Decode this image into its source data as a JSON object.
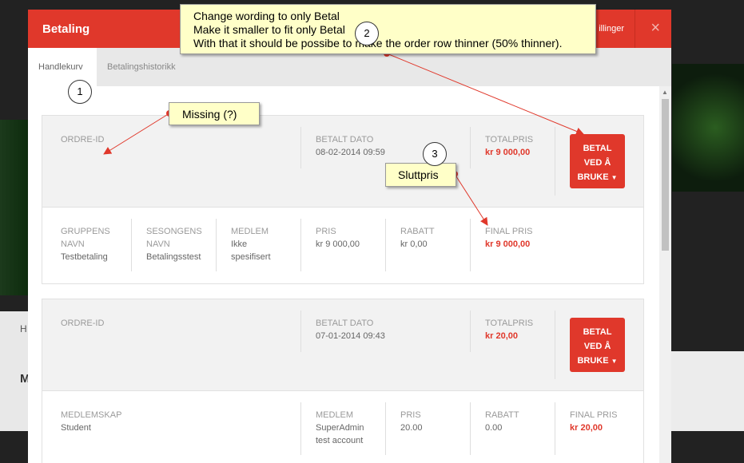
{
  "modal": {
    "title": "Betaling",
    "header_link": "illinger",
    "close": "×",
    "tabs": [
      {
        "label": "Handlekurv",
        "active": true
      },
      {
        "label": "Betalingshistorikk",
        "active": false
      }
    ]
  },
  "orders": [
    {
      "top": {
        "order_id_label": "ORDRE-ID",
        "order_id_value": "",
        "paid_date_label": "BETALT DATO",
        "paid_date_value": "08-02-2014 09:59",
        "total_label": "TOTALPRIS",
        "total_value": "kr 9 000,00",
        "pay_button": [
          "BETAL",
          "VED Å",
          "BRUKE"
        ]
      },
      "bottom": {
        "columns": [
          {
            "label": [
              "GRUPPENS",
              "NAVN"
            ],
            "value": [
              "Testbetaling"
            ]
          },
          {
            "label": [
              "SESONGENS",
              "NAVN"
            ],
            "value": [
              "Betalingsstest"
            ]
          },
          {
            "label": [
              "MEDLEM"
            ],
            "value": [
              "Ikke",
              "spesifisert"
            ]
          },
          {
            "label": [
              "PRIS"
            ],
            "value": [
              "kr 9 000,00"
            ]
          },
          {
            "label": [
              "RABATT"
            ],
            "value": [
              "kr 0,00"
            ]
          },
          {
            "label": [
              "FINAL PRIS"
            ],
            "value": [
              "kr 9 000,00"
            ]
          }
        ]
      }
    },
    {
      "top": {
        "order_id_label": "ORDRE-ID",
        "order_id_value": "",
        "paid_date_label": "BETALT DATO",
        "paid_date_value": "07-01-2014 09:43",
        "total_label": "TOTALPRIS",
        "total_value": "kr 20,00",
        "pay_button": [
          "BETAL",
          "VED Å",
          "BRUKE"
        ]
      },
      "bottom": {
        "columns": [
          {
            "label": [
              "MEDLEMSKAP"
            ],
            "value": [
              "Student"
            ]
          },
          {
            "label": [
              "MEDLEM"
            ],
            "value": [
              "SuperAdmin",
              "test account"
            ]
          },
          {
            "label": [
              "PRIS"
            ],
            "value": [
              "20.00"
            ]
          },
          {
            "label": [
              "RABATT"
            ],
            "value": [
              "0.00"
            ]
          },
          {
            "label": [
              "FINAL PRIS"
            ],
            "value": [
              "kr 20,00"
            ]
          }
        ]
      }
    }
  ],
  "annotations": {
    "note1": "Missing (?)",
    "note2": [
      "Change wording to only Betal",
      "Make it smaller to fit only Betal",
      "With that it should be possibe to make the order row thinner (50% thinner)."
    ],
    "note3": "Sluttpris",
    "circle1": "1",
    "circle2": "2",
    "circle3": "3"
  },
  "background": {
    "text_left": "H",
    "text_left2": "M"
  },
  "colors": {
    "accent": "#e0382b",
    "note_bg": "#ffffc8"
  }
}
